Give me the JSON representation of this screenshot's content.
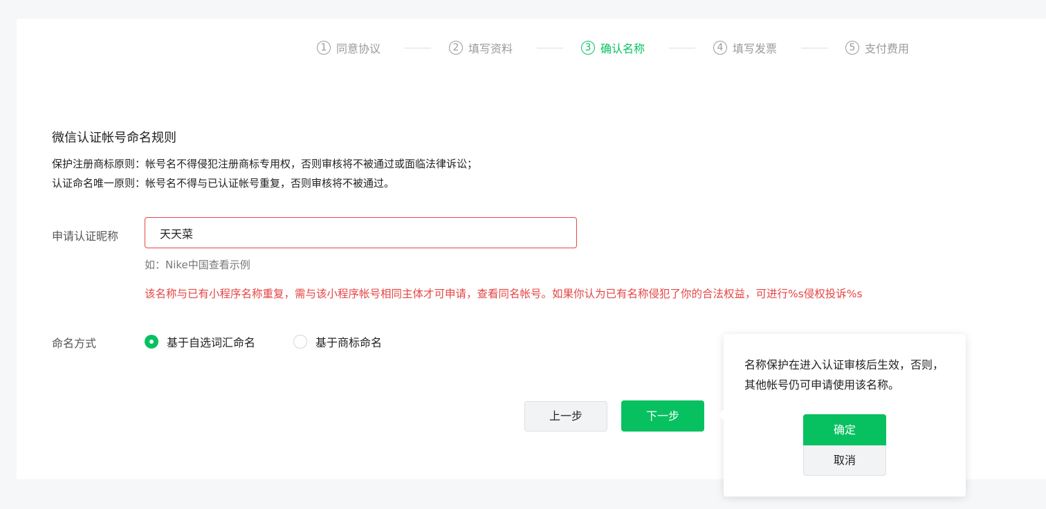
{
  "stepper": {
    "steps": [
      {
        "num": "1",
        "label": "同意协议"
      },
      {
        "num": "2",
        "label": "填写资料"
      },
      {
        "num": "3",
        "label": "确认名称"
      },
      {
        "num": "4",
        "label": "填写发票"
      },
      {
        "num": "5",
        "label": "支付费用"
      }
    ],
    "active_step": 3
  },
  "rules": {
    "title": "微信认证帐号命名规则",
    "line1": "保护注册商标原则：帐号名不得侵犯注册商标专用权，否则审核将不被通过或面临法律诉讼；",
    "line2": "认证命名唯一原则：帐号名不得与已认证帐号重复，否则审核将不被通过。"
  },
  "nickname": {
    "label": "申请认证昵称",
    "value": "天天菜",
    "hint": "如：Nike中国查看示例",
    "error": "该名称与已有小程序名称重复，需与该小程序帐号相同主体才可申请，查看同名帐号。如果你认为已有名称侵犯了你的合法权益，可进行%s侵权投诉%s"
  },
  "naming": {
    "label": "命名方式",
    "options": [
      {
        "label": "基于自选词汇命名",
        "selected": true
      },
      {
        "label": "基于商标命名",
        "selected": false
      }
    ]
  },
  "buttons": {
    "prev": "上一步",
    "next": "下一步"
  },
  "popover": {
    "text": "名称保护在进入认证审核后生效，否则，其他帐号仍可申请使用该名称。",
    "confirm": "确定",
    "cancel": "取消"
  },
  "colors": {
    "accent": "#07c160",
    "error": "#e54545"
  }
}
